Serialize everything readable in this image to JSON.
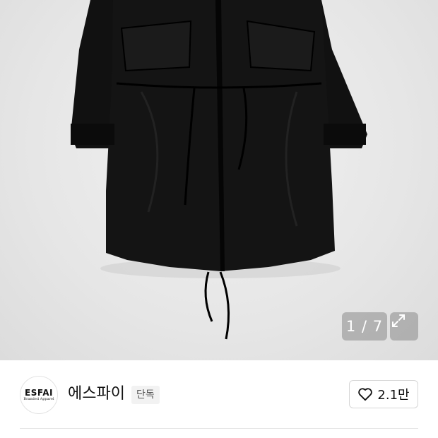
{
  "gallery": {
    "counter": "1 / 7",
    "image_alt": "black fishtail parka",
    "expand_icon": "expand-icon"
  },
  "brand": {
    "logo_main": "ESFAI",
    "logo_sub": "Branded Apparel",
    "name": "에스파이",
    "badge": "단독"
  },
  "like": {
    "icon": "heart-icon",
    "count": "2.1만"
  }
}
